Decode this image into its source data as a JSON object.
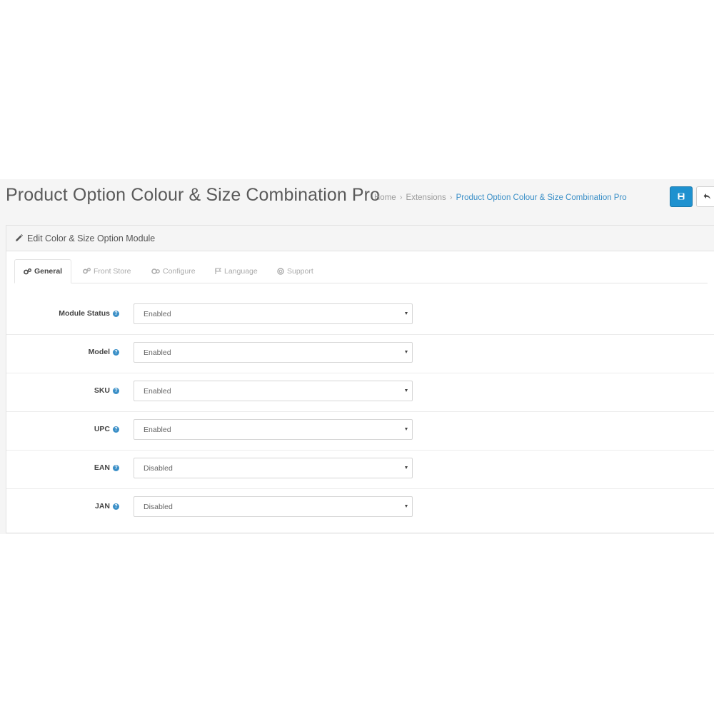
{
  "header": {
    "title": "Product Option Colour & Size Combination Pro",
    "breadcrumb": [
      "Home",
      "Extensions",
      "Product Option Colour & Size Combination Pro"
    ],
    "save_icon": "floppy-disk-icon",
    "back_icon": "reply-arrow-icon"
  },
  "panel": {
    "heading": "Edit Color & Size Option Module",
    "heading_icon": "pencil-icon"
  },
  "tabs": [
    {
      "label": "General",
      "icon": "cogs-icon",
      "active": true
    },
    {
      "label": "Front Store",
      "icon": "cogs-icon",
      "active": false
    },
    {
      "label": "Configure",
      "icon": "gears-icon",
      "active": false
    },
    {
      "label": "Language",
      "icon": "flag-icon",
      "active": false
    },
    {
      "label": "Support",
      "icon": "life-ring-icon",
      "active": false
    }
  ],
  "form": {
    "rows": [
      {
        "label": "Module Status",
        "value": "Enabled"
      },
      {
        "label": "Model",
        "value": "Enabled"
      },
      {
        "label": "SKU",
        "value": "Enabled"
      },
      {
        "label": "UPC",
        "value": "Enabled"
      },
      {
        "label": "EAN",
        "value": "Disabled"
      },
      {
        "label": "JAN",
        "value": "Disabled"
      }
    ],
    "help_glyph": "?"
  },
  "colors": {
    "primary": "#1e91cf",
    "link": "#3a8fc7"
  }
}
